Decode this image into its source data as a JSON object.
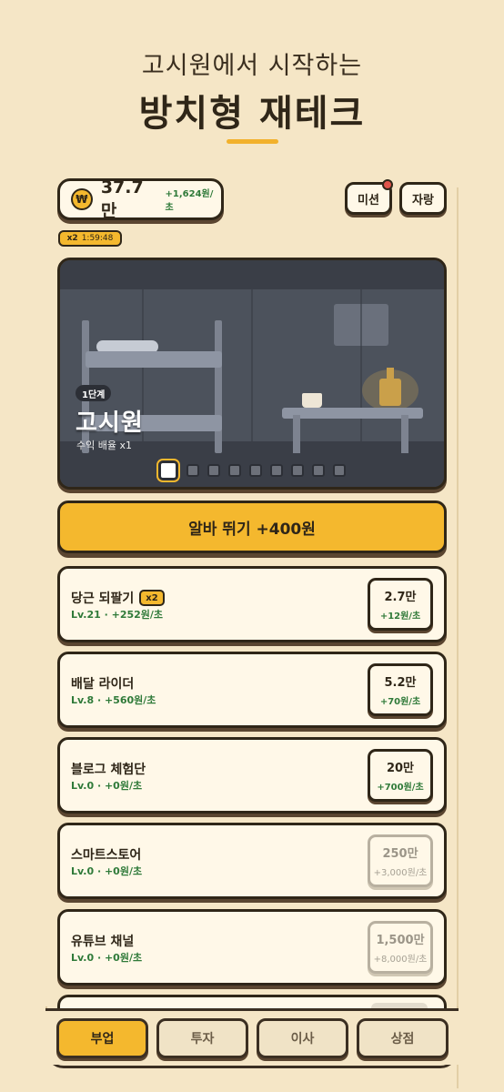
{
  "hero": {
    "subtitle": "고시원에서 시작하는",
    "title": "방치형 재테크"
  },
  "header": {
    "currency_icon": "₩",
    "money": "37.7만",
    "rate": "+1,624원/초",
    "mission_label": "미션",
    "brag_label": "자랑",
    "boost_mult": "x2",
    "boost_timer": "1:59:48"
  },
  "stage": {
    "badge": "1단계",
    "name": "고시원",
    "multiplier": "수익 배율 x1",
    "dot_count": 9,
    "active_dot": 0
  },
  "work_button": {
    "label": "알바 뛰기 +400원"
  },
  "jobs": [
    {
      "name": "당근 되팔기",
      "tag": "x2",
      "sub": "Lv.21 · +252원/초",
      "cost": "2.7만",
      "inc": "+12원/초",
      "enabled": true
    },
    {
      "name": "배달 라이더",
      "tag": "",
      "sub": "Lv.8 · +560원/초",
      "cost": "5.2만",
      "inc": "+70원/초",
      "enabled": true
    },
    {
      "name": "블로그 체험단",
      "tag": "",
      "sub": "Lv.0 · +0원/초",
      "cost": "20만",
      "inc": "+700원/초",
      "enabled": true
    },
    {
      "name": "스마트스토어",
      "tag": "",
      "sub": "Lv.0 · +0원/초",
      "cost": "250만",
      "inc": "+3,000원/초",
      "enabled": false
    },
    {
      "name": "유튜브 채널",
      "tag": "",
      "sub": "Lv.0 · +0원/초",
      "cost": "1,500만",
      "inc": "+8,000원/초",
      "enabled": false
    }
  ],
  "nav": {
    "tabs": [
      "부업",
      "투자",
      "이사",
      "상점"
    ],
    "active": 0
  },
  "colors": {
    "accent": "#f4b82e",
    "background": "#f5e6c6",
    "positive": "#2f7a39",
    "outline": "#2f2618"
  }
}
